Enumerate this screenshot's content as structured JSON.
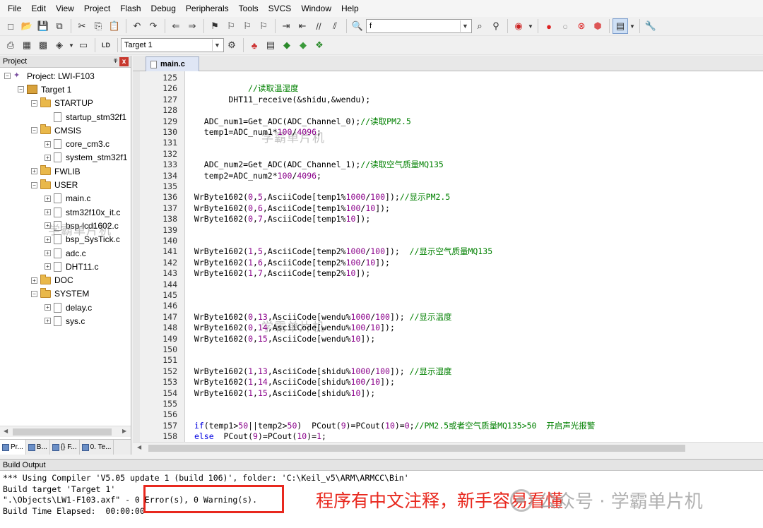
{
  "menu": [
    "File",
    "Edit",
    "View",
    "Project",
    "Flash",
    "Debug",
    "Peripherals",
    "Tools",
    "SVCS",
    "Window",
    "Help"
  ],
  "toolbar": {
    "find_value": "f",
    "target_select": "Target 1"
  },
  "project_panel": {
    "title": "Project",
    "pin": "ᵠ",
    "close": "x",
    "tree": [
      {
        "label": "Project: LWI-F103",
        "indent": 0,
        "icon": "project",
        "exp": "−"
      },
      {
        "label": "Target 1",
        "indent": 1,
        "icon": "target",
        "exp": "−"
      },
      {
        "label": "STARTUP",
        "indent": 2,
        "icon": "folder",
        "exp": "−"
      },
      {
        "label": "startup_stm32f1",
        "indent": 3,
        "icon": "file",
        "exp": ""
      },
      {
        "label": "CMSIS",
        "indent": 2,
        "icon": "folder",
        "exp": "−"
      },
      {
        "label": "core_cm3.c",
        "indent": 3,
        "icon": "file",
        "exp": "+"
      },
      {
        "label": "system_stm32f1",
        "indent": 3,
        "icon": "file",
        "exp": "+"
      },
      {
        "label": "FWLIB",
        "indent": 2,
        "icon": "folder",
        "exp": "+"
      },
      {
        "label": "USER",
        "indent": 2,
        "icon": "folder",
        "exp": "−"
      },
      {
        "label": "main.c",
        "indent": 3,
        "icon": "file",
        "exp": "+"
      },
      {
        "label": "stm32f10x_it.c",
        "indent": 3,
        "icon": "file",
        "exp": "+"
      },
      {
        "label": "bsp-lcd1602.c",
        "indent": 3,
        "icon": "file",
        "exp": "+"
      },
      {
        "label": "bsp_SysTick.c",
        "indent": 3,
        "icon": "file",
        "exp": "+"
      },
      {
        "label": "adc.c",
        "indent": 3,
        "icon": "file",
        "exp": "+"
      },
      {
        "label": "DHT11.c",
        "indent": 3,
        "icon": "file",
        "exp": "+"
      },
      {
        "label": "DOC",
        "indent": 2,
        "icon": "folder",
        "exp": "+"
      },
      {
        "label": "SYSTEM",
        "indent": 2,
        "icon": "folder",
        "exp": "−"
      },
      {
        "label": "delay.c",
        "indent": 3,
        "icon": "file",
        "exp": "+"
      },
      {
        "label": "sys.c",
        "indent": 3,
        "icon": "file",
        "exp": "+"
      }
    ],
    "tabs": [
      "Pr...",
      "B...",
      "{} F...",
      "0. Te..."
    ]
  },
  "editor": {
    "tab": "main.c",
    "lines": [
      {
        "n": "125",
        "code": ""
      },
      {
        "n": "126",
        "code": "            //读取温湿度"
      },
      {
        "n": "127",
        "code": "        DHT11_receive(&shidu,&wendu);"
      },
      {
        "n": "128",
        "code": ""
      },
      {
        "n": "129",
        "code": "   ADC_num1=Get_ADC(ADC_Channel_0);//读取PM2.5"
      },
      {
        "n": "130",
        "code": "   temp1=ADC_num1*100/4096;"
      },
      {
        "n": "131",
        "code": ""
      },
      {
        "n": "132",
        "code": ""
      },
      {
        "n": "133",
        "code": "   ADC_num2=Get_ADC(ADC_Channel_1);//读取空气质量MQ135"
      },
      {
        "n": "134",
        "code": "   temp2=ADC_num2*100/4096;"
      },
      {
        "n": "135",
        "code": ""
      },
      {
        "n": "136",
        "code": " WrByte1602(0,5,AsciiCode[temp1%1000/100]);//显示PM2.5"
      },
      {
        "n": "137",
        "code": " WrByte1602(0,6,AsciiCode[temp1%100/10]);"
      },
      {
        "n": "138",
        "code": " WrByte1602(0,7,AsciiCode[temp1%10]);"
      },
      {
        "n": "139",
        "code": ""
      },
      {
        "n": "140",
        "code": ""
      },
      {
        "n": "141",
        "code": " WrByte1602(1,5,AsciiCode[temp2%1000/100]);  //显示空气质量MQ135"
      },
      {
        "n": "142",
        "code": " WrByte1602(1,6,AsciiCode[temp2%100/10]);"
      },
      {
        "n": "143",
        "code": " WrByte1602(1,7,AsciiCode[temp2%10]);"
      },
      {
        "n": "144",
        "code": ""
      },
      {
        "n": "145",
        "code": ""
      },
      {
        "n": "146",
        "code": ""
      },
      {
        "n": "147",
        "code": " WrByte1602(0,13,AsciiCode[wendu%1000/100]); //显示温度"
      },
      {
        "n": "148",
        "code": " WrByte1602(0,14,AsciiCode[wendu%100/10]);"
      },
      {
        "n": "149",
        "code": " WrByte1602(0,15,AsciiCode[wendu%10]);"
      },
      {
        "n": "150",
        "code": ""
      },
      {
        "n": "151",
        "code": ""
      },
      {
        "n": "152",
        "code": " WrByte1602(1,13,AsciiCode[shidu%1000/100]); //显示湿度"
      },
      {
        "n": "153",
        "code": " WrByte1602(1,14,AsciiCode[shidu%100/10]);"
      },
      {
        "n": "154",
        "code": " WrByte1602(1,15,AsciiCode[shidu%10]);"
      },
      {
        "n": "155",
        "code": ""
      },
      {
        "n": "156",
        "code": ""
      },
      {
        "n": "157",
        "code": " if(temp1>50||temp2>50)  PCout(9)=PCout(10)=0;//PM2.5或者空气质量MQ135>50  开启声光报警"
      },
      {
        "n": "158",
        "code": " else  PCout(9)=PCout(10)=1;"
      }
    ]
  },
  "build_output": {
    "title": "Build Output",
    "lines": [
      "*** Using Compiler 'V5.05 update 1 (build 106)', folder: 'C:\\Keil_v5\\ARM\\ARMCC\\Bin'",
      "Build target 'Target 1'",
      "\".\\Objects\\LW1-F103.axf\" - 0 Error(s), 0 Warning(s).",
      "Build Time Elapsed:  00:00:00"
    ]
  },
  "annotation": "程序有中文注释，新手容易看懂",
  "watermark": {
    "brand": "公众号 · 学霸单片机",
    "text": "学霸单片机"
  },
  "colors": {
    "annotation_red": "#e8281e",
    "comment_green": "#008000",
    "keyword_blue": "#0000e0"
  }
}
